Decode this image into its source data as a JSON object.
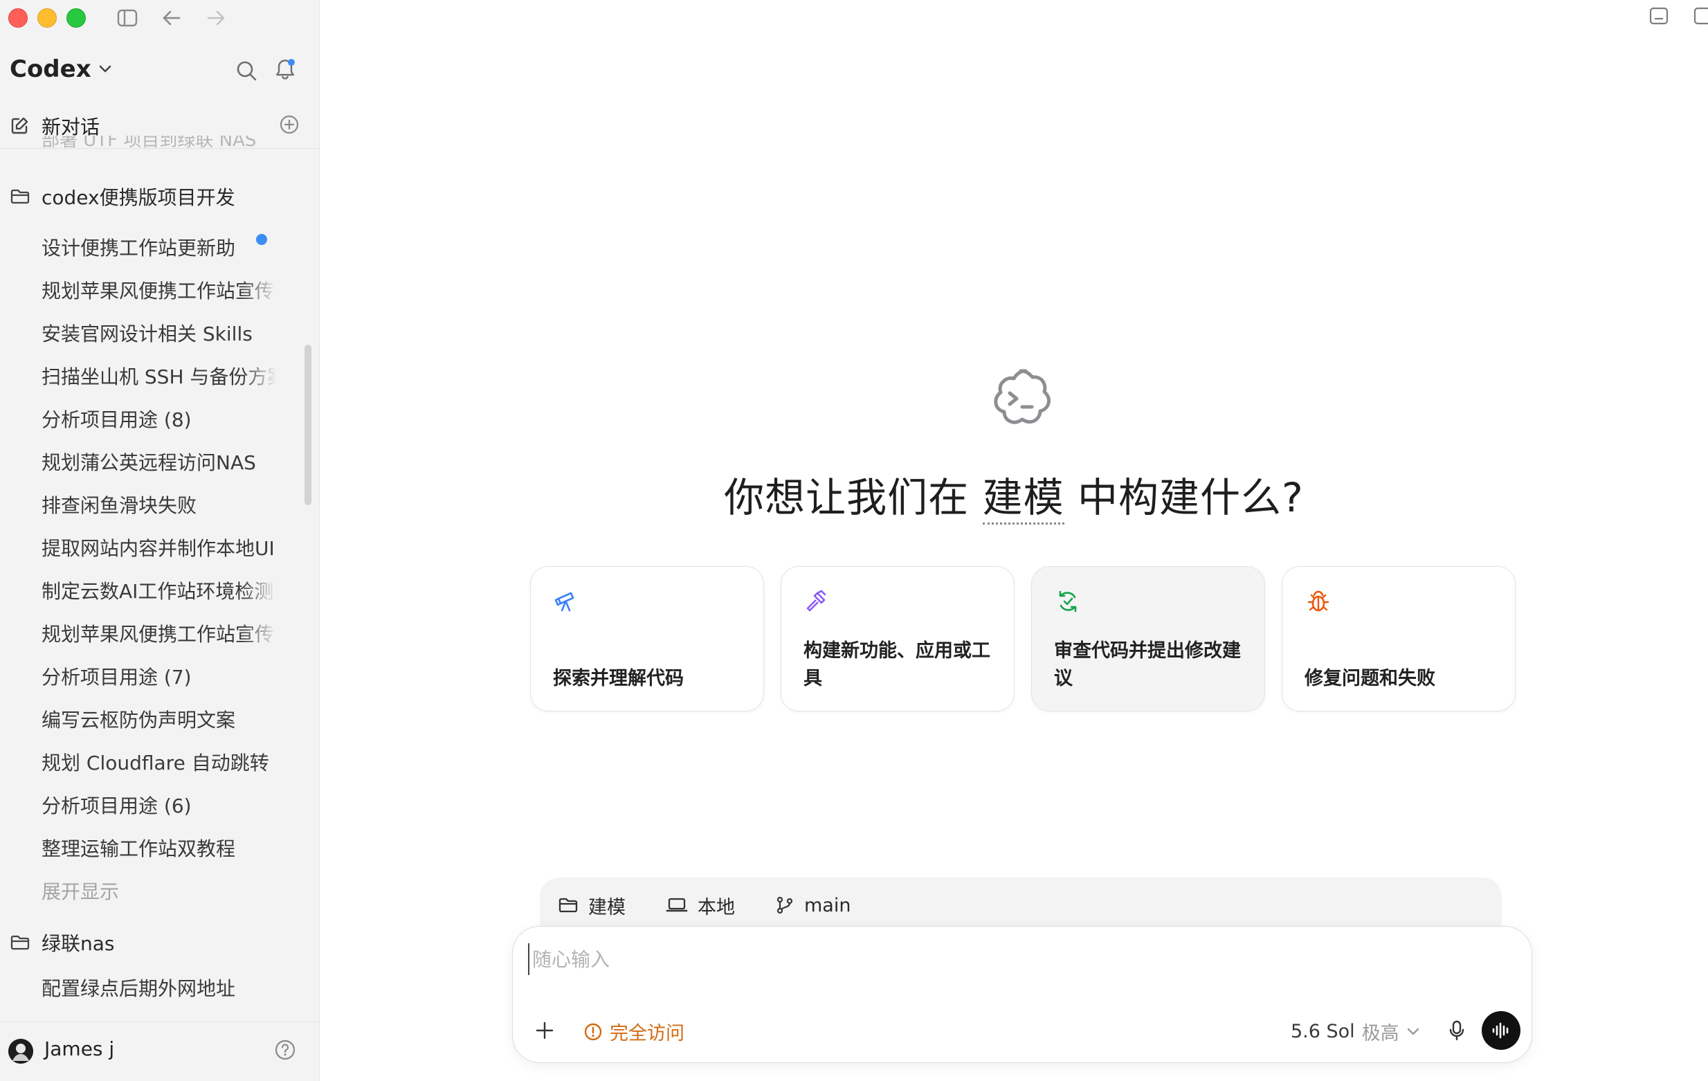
{
  "app": {
    "title": "Codex"
  },
  "sidebar": {
    "new_chat": "新对话",
    "faded_item": "部署 UTF 项目到绿联 NAS",
    "folders": [
      {
        "name": "codex便携版项目开发",
        "items": [
          {
            "label": "设计便携工作站更新助",
            "unread": true
          },
          {
            "label": "规划苹果风便携工作站宣传"
          },
          {
            "label": "安装官网设计相关 Skills"
          },
          {
            "label": "扫描坐山机 SSH 与备份方案"
          },
          {
            "label": "分析项目用途 (8)"
          },
          {
            "label": "规划蒲公英远程访问NAS"
          },
          {
            "label": "排查闲鱼滑块失败"
          },
          {
            "label": "提取网站内容并制作本地UI"
          },
          {
            "label": "制定云数AI工作站环境检测"
          },
          {
            "label": "规划苹果风便携工作站宣传"
          },
          {
            "label": "分析项目用途 (7)"
          },
          {
            "label": "编写云枢防伪声明文案"
          },
          {
            "label": "规划 Cloudflare 自动跳转"
          },
          {
            "label": "分析项目用途 (6)"
          },
          {
            "label": "整理运输工作站双教程"
          }
        ],
        "expand_label": "展开显示"
      },
      {
        "name": "绿联nas",
        "items": [
          {
            "label": "配置绿点后期外网地址"
          }
        ]
      }
    ],
    "user": {
      "name": "James j"
    }
  },
  "main": {
    "headline_pre": "你想让我们在",
    "headline_project": "建模",
    "headline_post": "中构建什么?",
    "cards": [
      {
        "icon": "telescope-icon",
        "label": "探索并理解代码",
        "color": "#3b82f6"
      },
      {
        "icon": "hammer-icon",
        "label": "构建新功能、应用或工具",
        "color": "#8b5cf6"
      },
      {
        "icon": "review-icon",
        "label": "审查代码并提出修改建议",
        "color": "#16a34a"
      },
      {
        "icon": "bug-icon",
        "label": "修复问题和失败",
        "color": "#ea580c"
      }
    ],
    "context": {
      "project": "建模",
      "env": "本地",
      "branch": "main"
    },
    "composer": {
      "placeholder": "随心输入",
      "access": "完全访问",
      "model": "5.6 Sol",
      "level": "极高"
    }
  },
  "colors": {
    "accent_blue": "#3b8df5",
    "access_orange": "#d26a12"
  }
}
